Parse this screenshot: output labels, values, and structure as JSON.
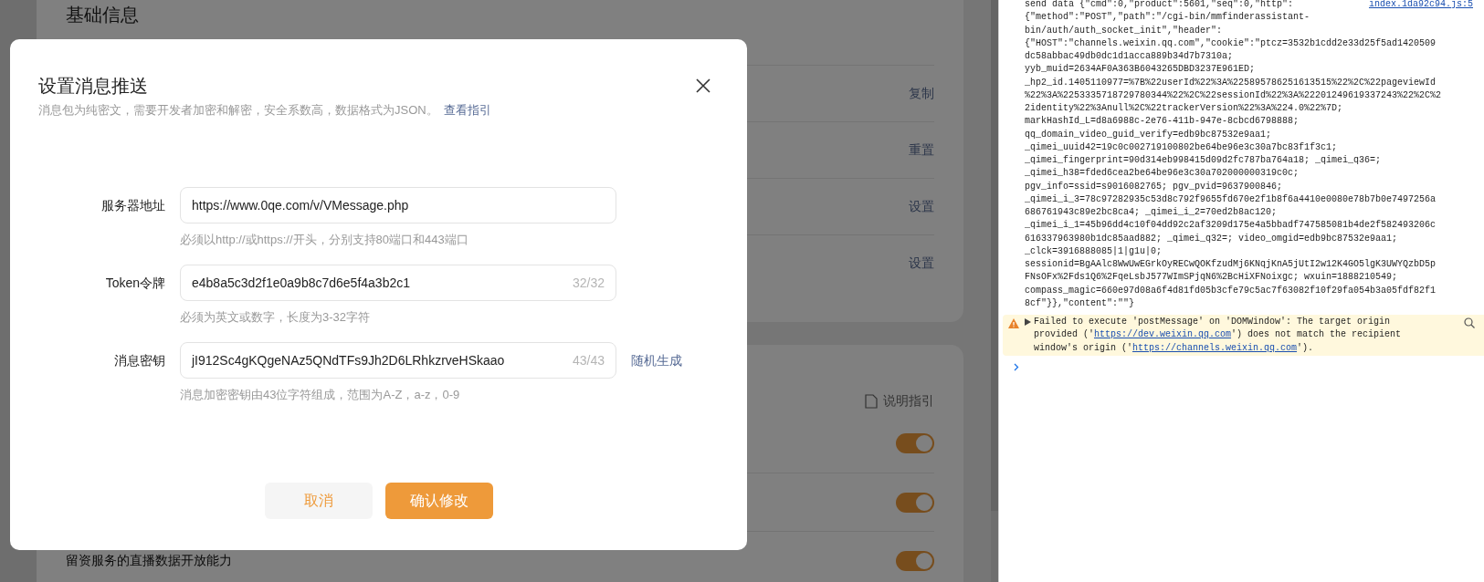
{
  "background": {
    "section_title": "基础信息",
    "actions": [
      "复制",
      "重置",
      "设置",
      "设置"
    ],
    "guide_link": "说明指引",
    "toggle_rows": [
      {
        "on": true
      },
      {
        "on": true
      },
      {
        "label": "留资服务的直播数据开放能力",
        "on": true
      }
    ]
  },
  "dialog": {
    "title": "设置消息推送",
    "subtitle": "消息包为纯密文，需要开发者加密和解密，安全系数高，数据格式为JSON。",
    "subtitle_link": "查看指引",
    "fields": [
      {
        "label": "服务器地址",
        "value": "https://www.0qe.com/v/VMessage.php",
        "hint": "必须以http://或https://开头，分别支持80端口和443端口"
      },
      {
        "label": "Token令牌",
        "value": "e4b8a5c3d2f1e0a9b8c7d6e5f4a3b2c1",
        "counter": "32/32",
        "hint": "必须为英文或数字，长度为3-32字符"
      },
      {
        "label": "消息密钥",
        "value": "jI912Sc4gKQgeNAz5QNdTFs9Jh2D6LRhkzrveHSkaao",
        "counter": "43/43",
        "action": "随机生成",
        "hint": "消息加密密钥由43位字符组成，范围为A-Z，a-z，0-9"
      }
    ],
    "buttons": [
      {
        "label": "取消",
        "kind": "secondary"
      },
      {
        "label": "确认修改",
        "kind": "primary"
      }
    ]
  },
  "console": {
    "source_link": "index.1da92c94.js:5",
    "log_lines": [
      "send data {\"cmd\":0,\"product\":5601,\"seq\":0,\"http\":",
      "{\"method\":\"POST\",\"path\":\"/cgi-bin/mmfinderassistant-",
      "bin/auth/auth_socket_init\",\"header\":",
      "{\"HOST\":\"channels.weixin.qq.com\",\"cookie\":\"ptcz=3532b1cdd2e33d25f5ad1420509",
      "dc58abbac49db0dc1d1acca889b34d7b7310a;",
      "yyb_muid=2634AF0A363B6043265DBD3237E961ED;",
      "_hp2_id.1405110977=%7B%22userId%22%3A%225895786251613515%22%2C%22pageviewId",
      "%22%3A%2253335718729780344%22%2C%22sessionId%22%3A%22201249619337243%22%2C%2",
      "2identity%22%3Anull%2C%22trackerVersion%22%3A%224.0%22%7D;",
      "markHashId_L=d8a6988c-2e76-411b-947e-8cbcd6798888;",
      "qq_domain_video_guid_verify=edb9bc87532e9aa1;",
      "_qimei_uuid42=19c0c002719100802be64be96e3c30a7bc83f1f3c1;",
      "_qimei_fingerprint=90d314eb998415d09d2fc787ba764a18; _qimei_q36=;",
      "_qimei_h38=fded6cea2be64be96e3c30a702000000319c0c;",
      "pgv_info=ssid=s9016082765; pgv_pvid=9637900846;",
      "_qimei_i_3=78c97282935c53d8c792f9655fd670e2f1b8f6a4410e0080e78b7b0e7497256a",
      "686761943c89e2bc8ca4; _qimei_i_2=70ed2b8ac120;",
      "_qimei_i_1=45b96dd4c10f04dd92c2af3209d175e4a5bbadf747585081b4de2f582493206c",
      "616337963980b1dc85aad882; _qimei_q32=; video_omgid=edb9bc87532e9aa1;",
      "_clck=3916888085|1|g1u|0;",
      "sessionid=BgAAlc8WwUwEGrkOyRECwQOKfzudMj6KNqjKnA5jUtI2w12K4GO5lgK3UWYQzbD5p",
      "FNsOFx%2Fds1Q6%2FqeLsbJ577WImSPjqN6%2BcHiXFNoixgc; wxuin=1888210549;",
      "compass_magic=660e97d08a6f4d81fd05b3cfe79c5ac7f63082f10f29fa054b3a05fdf82f1",
      "8cf\"}},\"content\":\"\"}"
    ],
    "warning": [
      {
        "kind": "text",
        "text": "Failed to execute 'postMessage' on 'DOMWindow': The target origin provided ('"
      },
      {
        "kind": "link",
        "text": "https://dev.weixin.qq.com"
      },
      {
        "kind": "text",
        "text": "') does not match the recipient window's origin ('"
      },
      {
        "kind": "link",
        "text": "https://channels.weixin.qq.com"
      },
      {
        "kind": "text",
        "text": "')."
      }
    ]
  }
}
